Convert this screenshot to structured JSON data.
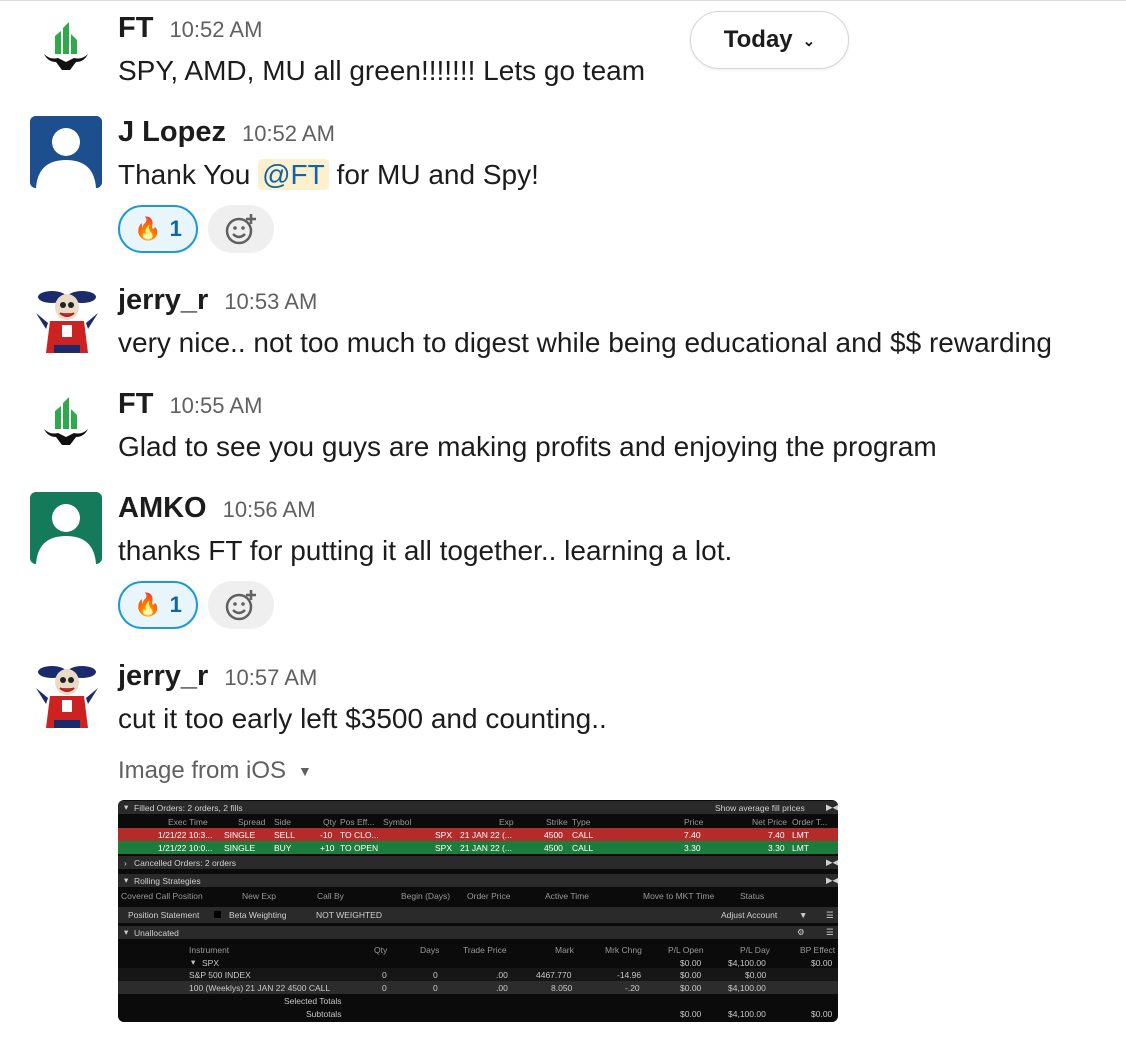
{
  "date_pill": {
    "label": "Today",
    "chevron_icon": "chevron-down-icon"
  },
  "messages": [
    {
      "name": "FT",
      "time": "10:52 AM",
      "text": "SPY, AMD, MU all green!!!!!!! Lets go team"
    },
    {
      "name": "J Lopez",
      "time": "10:52 AM",
      "text_before": "Thank You ",
      "mention": "@FT",
      "text_after": " for MU and Spy!",
      "reaction": {
        "emoji": "🔥",
        "count": "1"
      }
    },
    {
      "name": "jerry_r",
      "time": "10:53 AM",
      "text": "very nice.. not too much to digest while being educational and $$ rewarding"
    },
    {
      "name": "FT",
      "time": "10:55 AM",
      "text": "Glad to see you guys are making profits and enjoying the program"
    },
    {
      "name": "AMKO",
      "time": "10:56 AM",
      "text": "thanks FT for putting it all together.. learning a lot.",
      "reaction": {
        "emoji": "🔥",
        "count": "1"
      }
    },
    {
      "name": "jerry_r",
      "time": "10:57 AM",
      "text": "cut it too early left $3500 and counting..",
      "attachment_label": "Image from iOS"
    }
  ],
  "screenshot": {
    "filled_title": "Filled Orders: 2 orders, 2 fills",
    "show_avg": "Show average fill prices",
    "order_headers": [
      "Exec Time",
      "Spread",
      "Side",
      "Qty",
      "Pos Eff...",
      "Symbol",
      "Exp",
      "Strike",
      "Type",
      "Price",
      "Net Price",
      "Order T..."
    ],
    "orders": [
      [
        "1/21/22 10:3...",
        "SINGLE",
        "SELL",
        "-10",
        "TO CLO...",
        "SPX",
        "21 JAN 22 (...",
        "4500",
        "CALL",
        "7.40",
        "7.40",
        "LMT"
      ],
      [
        "1/21/22 10:0...",
        "SINGLE",
        "BUY",
        "+10",
        "TO OPEN",
        "SPX",
        "21 JAN 22 (...",
        "4500",
        "CALL",
        "3.30",
        "3.30",
        "LMT"
      ]
    ],
    "cancelled": "Cancelled Orders: 2 orders",
    "rolling": "Rolling Strategies",
    "rolling_headers": [
      "Covered Call Position",
      "New Exp",
      "Call By",
      "Begin (Days)",
      "Order Price",
      "Active Time",
      "Move to MKT Time",
      "Status"
    ],
    "position_statement": "Position Statement",
    "beta_weighting": "Beta Weighting",
    "not_weighted": "NOT WEIGHTED",
    "adjust_account": "Adjust Account",
    "unallocated": "Unallocated",
    "pos_headers": [
      "Instrument",
      "Qty",
      "Days",
      "Trade Price",
      "Mark",
      "Mrk Chng",
      "P/L Open",
      "P/L Day",
      "BP Effect"
    ],
    "spx_row": [
      "SPX",
      "",
      "",
      "",
      "",
      "",
      "$0.00",
      "$4,100.00",
      "$0.00"
    ],
    "rows": [
      [
        "S&P 500 INDEX",
        "0",
        "0",
        ".00",
        "4467.770",
        "-14.96",
        "$0.00",
        "$0.00",
        ""
      ],
      [
        "100 (Weeklys) 21 JAN 22 4500 CALL",
        "0",
        "0",
        ".00",
        "8.050",
        "-.20",
        "$0.00",
        "$4,100.00",
        ""
      ]
    ],
    "selected_totals": "Selected Totals",
    "subtotals": "Subtotals",
    "subtotal_values": [
      "$0.00",
      "$4,100.00",
      "$0.00"
    ]
  }
}
